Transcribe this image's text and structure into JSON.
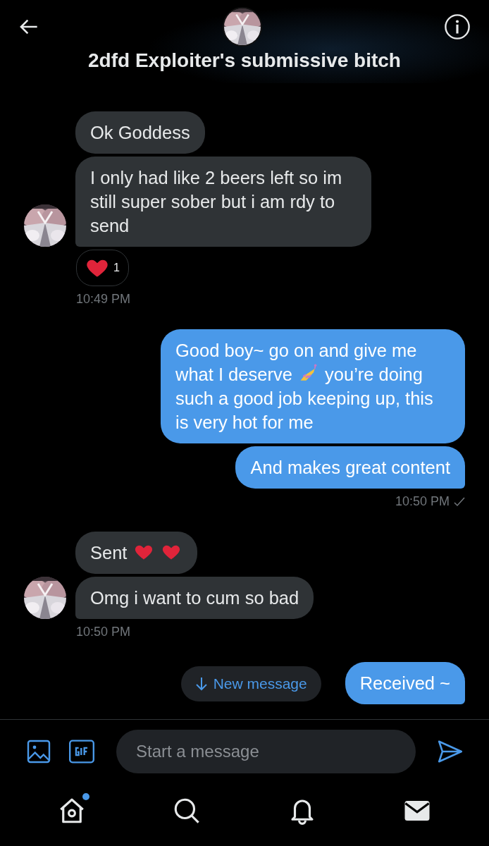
{
  "header": {
    "title": "2dfd Exploiter's submissive bitch"
  },
  "thread": [
    {
      "kind": "received",
      "bubbles": [
        {
          "parts": [
            {
              "kind": "text",
              "text": "Ok Goddess"
            }
          ]
        },
        {
          "parts": [
            {
              "kind": "text",
              "text": "I only had like 2 beers left so im still super sober but i am rdy to send"
            }
          ]
        }
      ],
      "reaction": {
        "kind": "heart",
        "count": "1"
      },
      "time": "10:49 PM",
      "delivered": false
    },
    {
      "kind": "sent",
      "bubbles": [
        {
          "parts": [
            {
              "kind": "text",
              "text": "Good boy~ go on and give me what I deserve"
            },
            {
              "kind": "nail-polish"
            },
            {
              "kind": "text",
              "text": "you’re doing such a good job keeping up, this is very hot for me"
            }
          ]
        },
        {
          "parts": [
            {
              "kind": "text",
              "text": "And makes great content"
            }
          ]
        }
      ],
      "time": "10:50 PM",
      "delivered": true
    },
    {
      "kind": "received",
      "bubbles": [
        {
          "parts": [
            {
              "kind": "text",
              "text": "Sent"
            },
            {
              "kind": "heart"
            },
            {
              "kind": "heart"
            }
          ]
        },
        {
          "parts": [
            {
              "kind": "text",
              "text": "Omg i want to cum so bad"
            }
          ]
        }
      ],
      "time": "10:50 PM",
      "delivered": false
    },
    {
      "kind": "sent",
      "bubbles": [
        {
          "parts": [
            {
              "kind": "text",
              "text": "Received ~"
            }
          ]
        }
      ],
      "new_message_button": {
        "label": "New message"
      }
    }
  ],
  "composer": {
    "placeholder": "Start a message"
  },
  "nav": [
    {
      "kind": "home",
      "selected": false,
      "badge": true
    },
    {
      "kind": "search",
      "selected": false,
      "badge": false
    },
    {
      "kind": "bell",
      "selected": false,
      "badge": false
    },
    {
      "kind": "mail",
      "selected": true,
      "badge": false
    }
  ]
}
